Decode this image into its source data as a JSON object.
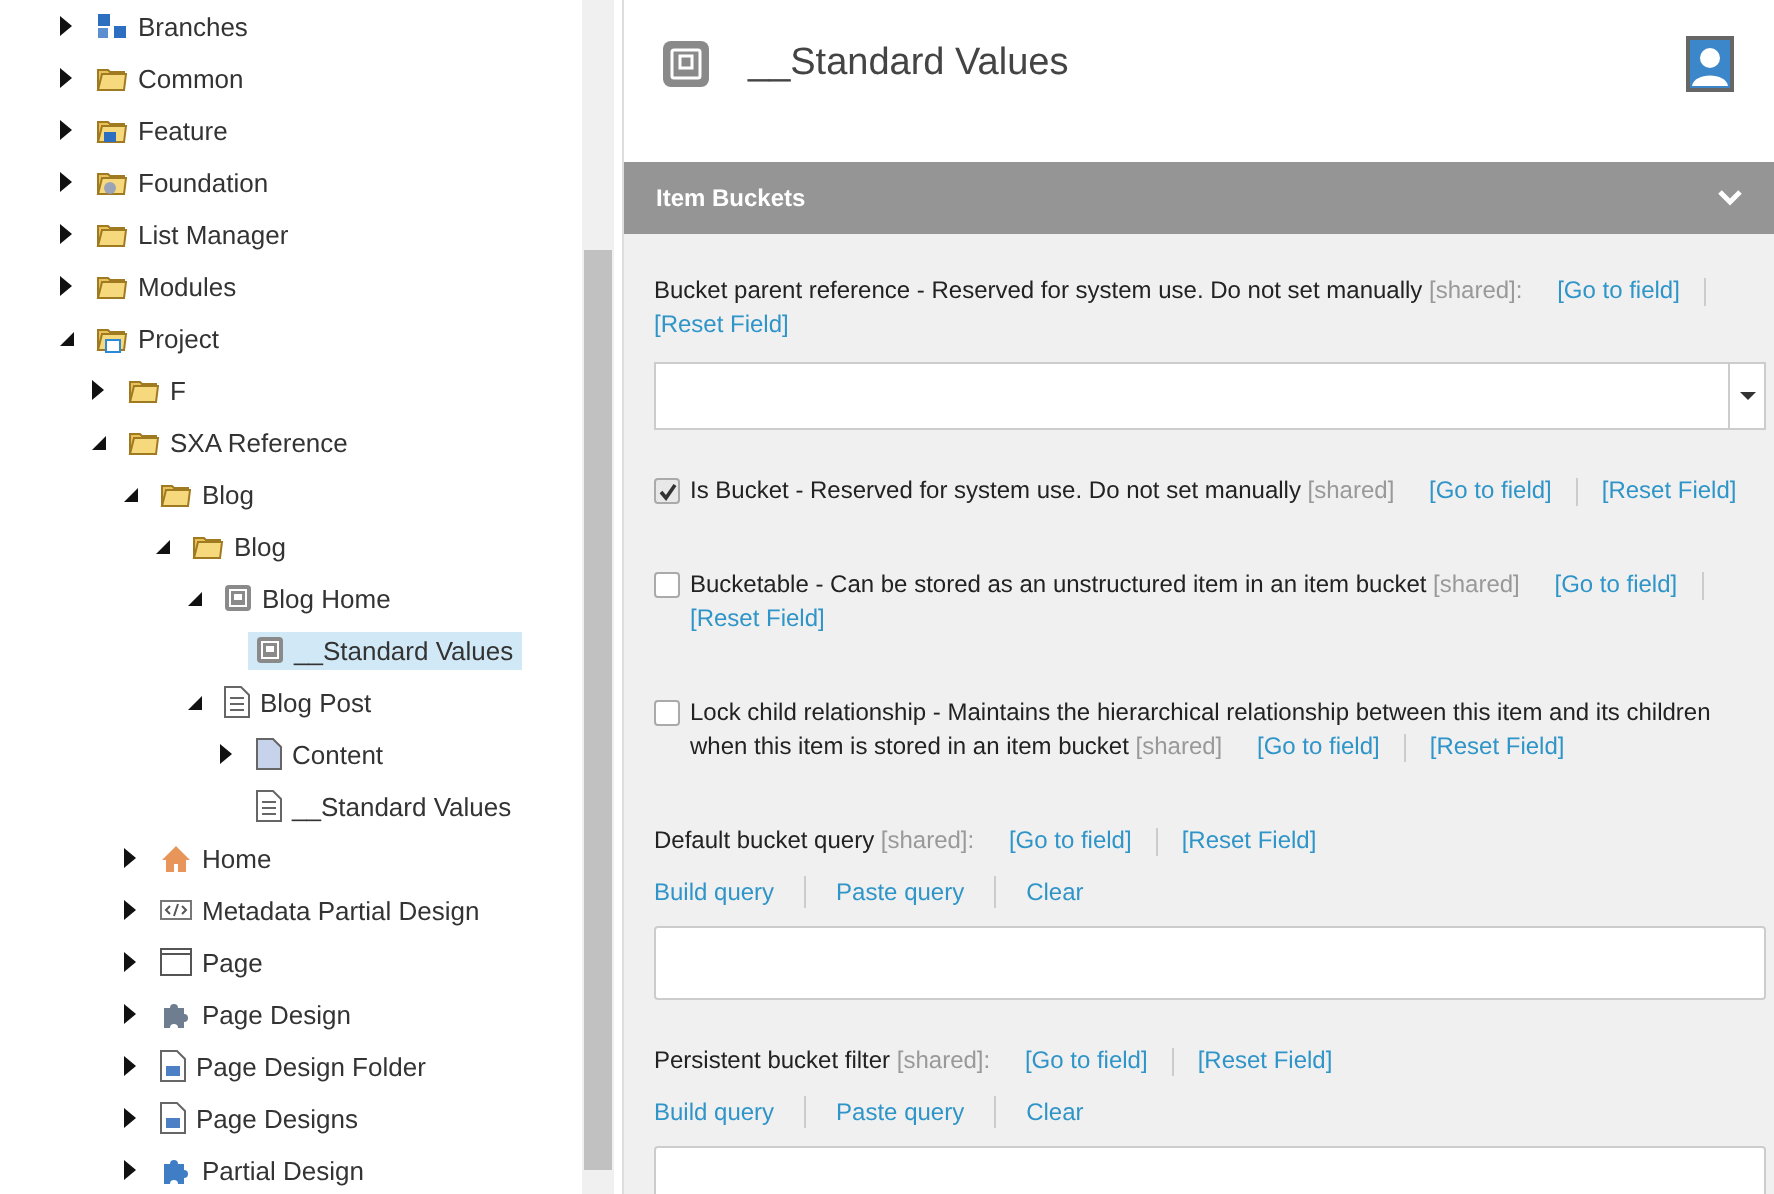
{
  "tree": [
    {
      "label": "Branches",
      "expanded": false
    },
    {
      "label": "Common",
      "expanded": false
    },
    {
      "label": "Feature",
      "expanded": false
    },
    {
      "label": "Foundation",
      "expanded": false
    },
    {
      "label": "List Manager",
      "expanded": false
    },
    {
      "label": "Modules",
      "expanded": false
    },
    {
      "label": "Project",
      "expanded": true,
      "children": [
        {
          "label": "F",
          "expanded": false
        },
        {
          "label": "SXA Reference",
          "expanded": true,
          "children": [
            {
              "label": "Blog",
              "expanded": true,
              "children": [
                {
                  "label": "Blog",
                  "expanded": true,
                  "children": [
                    {
                      "label": "Blog Home",
                      "expanded": true,
                      "children": [
                        {
                          "label": "__Standard Values",
                          "selected": true
                        }
                      ]
                    },
                    {
                      "label": "Blog Post",
                      "expanded": true,
                      "children": [
                        {
                          "label": "Content",
                          "expanded": false
                        },
                        {
                          "label": "__Standard Values",
                          "selected": false
                        }
                      ]
                    }
                  ]
                }
              ]
            },
            {
              "label": "Home",
              "expanded": false
            },
            {
              "label": "Metadata Partial Design",
              "expanded": false
            },
            {
              "label": "Page",
              "expanded": false
            },
            {
              "label": "Page Design",
              "expanded": false
            },
            {
              "label": "Page Design Folder",
              "expanded": false
            },
            {
              "label": "Page Designs",
              "expanded": false
            },
            {
              "label": "Partial Design",
              "expanded": false
            }
          ]
        }
      ]
    }
  ],
  "item": {
    "title": "__Standard Values"
  },
  "section": {
    "title": "Item Buckets",
    "expanded": true
  },
  "fields": [
    {
      "kind": "dropdown",
      "label": "Bucket parent reference - Reserved for system use. Do not set manually",
      "shared": "[shared]:",
      "go": "[Go to field]",
      "reset": "[Reset Field]"
    },
    {
      "kind": "checkbox",
      "checked": true,
      "label": "Is Bucket - Reserved for system use. Do not set manually",
      "shared": "[shared]",
      "go": "[Go to field]",
      "reset": "[Reset Field]"
    },
    {
      "kind": "checkbox",
      "checked": false,
      "label": "Bucketable - Can be stored as an unstructured item in an item bucket",
      "shared": "[shared]",
      "go": "[Go to field]",
      "reset": "[Reset Field]"
    },
    {
      "kind": "checkbox",
      "checked": false,
      "label": "Lock child relationship - Maintains the hierarchical relationship between this item and its children when this item is stored in an item bucket",
      "shared": "[shared]",
      "go": "[Go to field]",
      "reset": "[Reset Field]"
    },
    {
      "kind": "query",
      "label": "Default bucket query",
      "shared": "[shared]:",
      "go": "[Go to field]",
      "reset": "[Reset Field]",
      "actions": [
        "Build query",
        "Paste query",
        "Clear"
      ]
    },
    {
      "kind": "query",
      "label": "Persistent bucket filter",
      "shared": "[shared]:",
      "go": "[Go to field]",
      "reset": "[Reset Field]",
      "actions": [
        "Build query",
        "Paste query",
        "Clear"
      ]
    }
  ]
}
